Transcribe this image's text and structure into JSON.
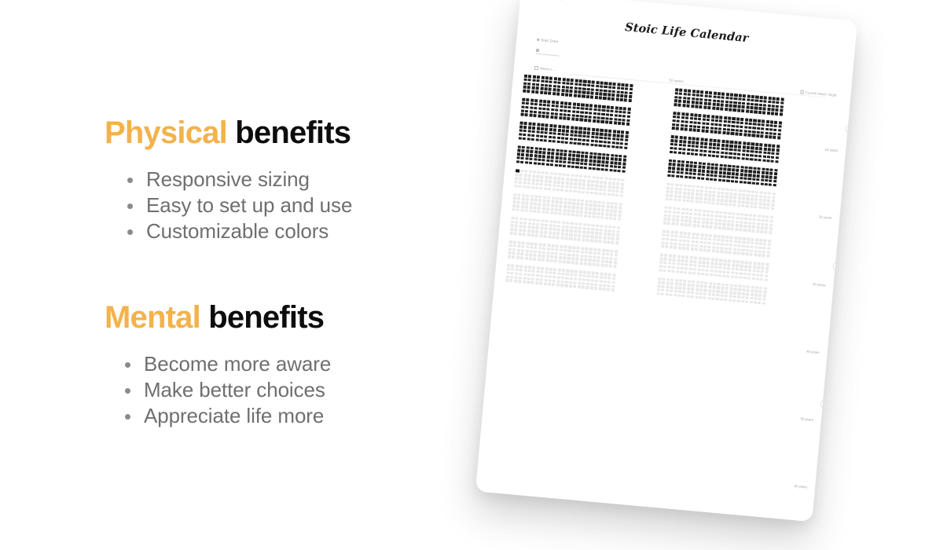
{
  "slide": {
    "background_color": "#ffffff",
    "accent_color": "#F3B24C",
    "heading_color": "#0d0d0d",
    "body_color": "#6f6f6f"
  },
  "sections": [
    {
      "id": "physical",
      "heading_accent": "Physical",
      "heading_plain": " benefits",
      "items": [
        "Responsive sizing",
        "Easy to set up and use",
        "Customizable colors"
      ]
    },
    {
      "id": "mental",
      "heading_accent": "Mental",
      "heading_plain": " benefits",
      "items": [
        "Become more aware",
        "Make better choices",
        "Appreciate life more"
      ]
    }
  ],
  "mockup": {
    "app_title": "Stoic Life Calendar",
    "start_date_label": "Start Date",
    "start_date_value": "",
    "toolbar": {
      "left_label": "Weeks L...",
      "center_label": "52 weeks",
      "right_label": "Current Week: Right"
    },
    "age_ticks": [
      "10 years",
      "20 years",
      "30 years",
      "40 years",
      "50 years",
      "60 years"
    ],
    "rail_markers": [
      "?",
      "?",
      "?"
    ],
    "grid": {
      "weeks_per_row": 26,
      "rows_per_block": 5,
      "blocks_per_column": 9,
      "columns": 2,
      "filled_blocks": 4,
      "filled_color": "#1e1e1e",
      "empty_color": "#e9e9e9",
      "current_week_block": 4,
      "current_week_row": 0,
      "current_week_index": 0
    }
  }
}
